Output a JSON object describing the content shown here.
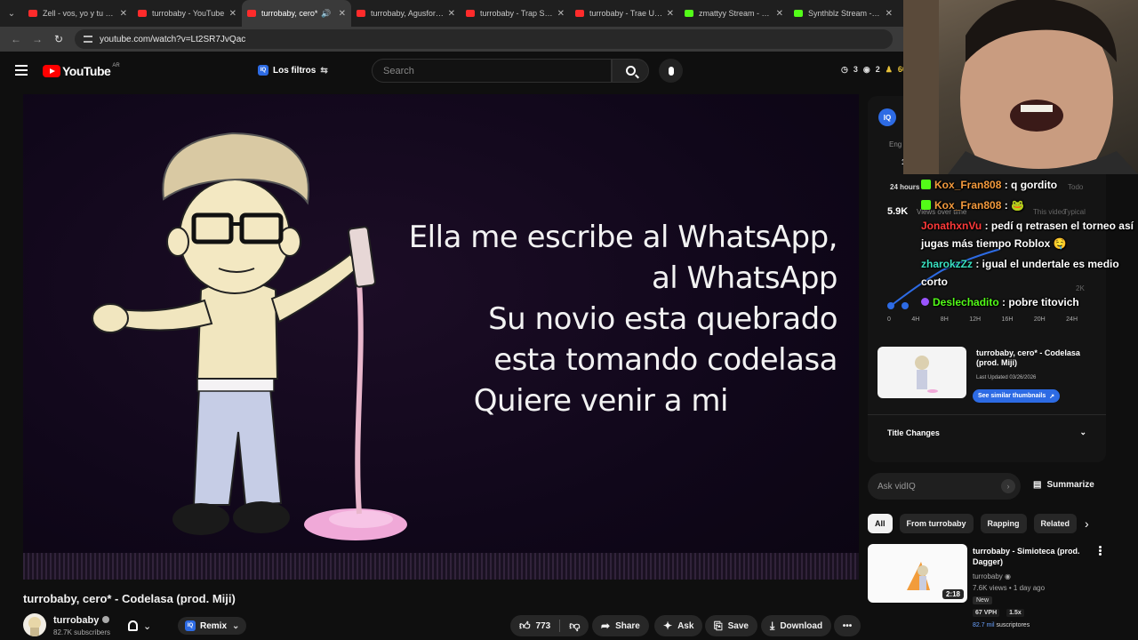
{
  "browser": {
    "tabs": [
      {
        "title": "Zell - vos, yo y tu Ego",
        "icon": "youtube-favicon",
        "active": false
      },
      {
        "title": "turrobaby - YouTube",
        "icon": "youtube-favicon",
        "active": false
      },
      {
        "title": "turrobaby, cero*",
        "icon": "youtube-favicon",
        "active": true,
        "audio": true
      },
      {
        "title": "turrobaby, Agusfortnite",
        "icon": "youtube-favicon",
        "active": false
      },
      {
        "title": "turrobaby - Trap Simio",
        "icon": "youtube-favicon",
        "active": false
      },
      {
        "title": "turrobaby - Trae Un S",
        "icon": "youtube-favicon",
        "active": false
      },
      {
        "title": "zmattyy Stream - Wa",
        "icon": "kick-favicon",
        "active": false
      },
      {
        "title": "Synthblz Stream - Wa",
        "icon": "kick-favicon",
        "active": false
      }
    ],
    "url": "youtube.com/watch?v=Lt2SR7JvQac"
  },
  "youtube": {
    "logo_text": "YouTube",
    "region": "AR",
    "filters_label": "Los filtros",
    "search_placeholder": "Search",
    "header_stats": {
      "a": "3",
      "b": "2",
      "c": "60"
    }
  },
  "video": {
    "lyrics": [
      "Ella me escribe al WhatsApp,",
      "al WhatsApp",
      "Su novio esta quebrado",
      "esta tomando codelasa",
      "Quiere venir a mi"
    ],
    "title": "turrobaby, cero* - Codelasa (prod. Miji)",
    "channel": "turrobaby",
    "subscribers": "82.7K subscribers",
    "remix_label": "Remix",
    "likes": "773",
    "share_label": "Share",
    "ask_label": "Ask",
    "save_label": "Save",
    "download_label": "Download"
  },
  "vidiq": {
    "badge": "IQ",
    "eng_label": "Eng",
    "eng_value": "1",
    "range_label": "24 hours",
    "views": "5.9K",
    "views_label": "Views over time",
    "per_video": "Todo",
    "typical_label": "Typical",
    "this_video_label": "This video",
    "y_label_2k": "2K",
    "chart_ticks": [
      "0",
      "4H",
      "8H",
      "12H",
      "16H",
      "20H",
      "24H"
    ],
    "thumb_title": "turrobaby, cero* - Codelasa (prod. Miji)",
    "last_updated": "Last Updated 03/26/2026",
    "similar_label": "See similar thumbnails",
    "title_changes": "Title Changes",
    "ask_placeholder": "Ask vidIQ",
    "summarize_label": "Summarize"
  },
  "chips": [
    "All",
    "From turrobaby",
    "Rapping",
    "Related"
  ],
  "recommended": {
    "title": "turrobaby - Simioteca (prod. Dagger)",
    "channel": "turrobaby",
    "meta": "7.6K views • 1 day ago",
    "badge": "New",
    "duration": "2:18",
    "vph": "67 VPH",
    "multiplier": "1.5x",
    "subs_value": "82.7 mil",
    "subs_label": " suscriptores"
  },
  "chat": [
    {
      "user": "Kox_Fran808",
      "color": "#f39a3d",
      "badge": "kick",
      "message": " : q gordito"
    },
    {
      "user": "Kox_Fran808",
      "color": "#f39a3d",
      "badge": "kick",
      "message": " : 🐸"
    },
    {
      "user": "JonathxnVu",
      "color": "#ff3a3a",
      "badge": "none",
      "message": " : pedí q retrasen el torneo así jugas más tiempo Roblox 🤤"
    },
    {
      "user": "zharokzZz",
      "color": "#39e0c0",
      "badge": "none",
      "message": " : igual el undertale es medio corto"
    },
    {
      "user": "Deslechadito",
      "color": "#53fc18",
      "badge": "emote",
      "message": " : pobre titovich"
    }
  ]
}
